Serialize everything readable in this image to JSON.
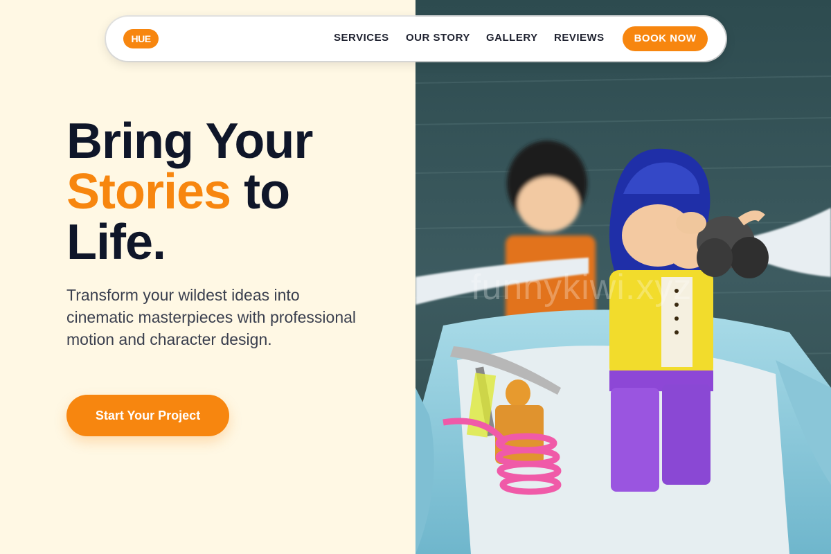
{
  "nav": {
    "logo": "HUE",
    "links": [
      "SERVICES",
      "OUR STORY",
      "GALLERY",
      "REVIEWS"
    ],
    "cta": "BOOK NOW"
  },
  "hero": {
    "line1": "Bring Your",
    "accent": "Stories",
    "line2_rest": " to",
    "line3": "Life.",
    "subtitle": "Transform your wildest ideas into cinematic masterpieces with professional motion and character design.",
    "button": "Start Your Project"
  },
  "image": {
    "watermark": "funnykiwi.xyz",
    "description_icon": "lego-minifigures-boat-photo"
  },
  "colors": {
    "accent": "#f7860f",
    "background": "#fff8e4",
    "heading": "#0f1629"
  }
}
